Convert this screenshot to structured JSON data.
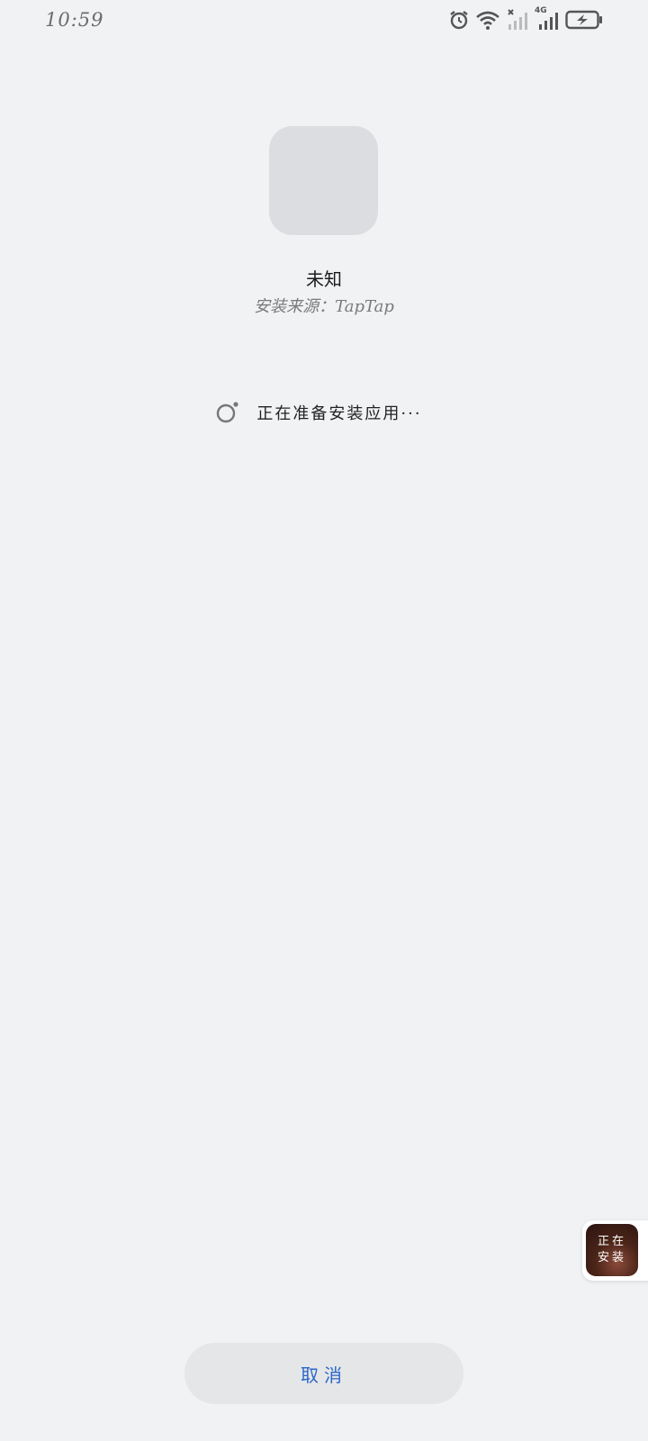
{
  "status_bar": {
    "time": "10:59",
    "network_label": "4G",
    "icons": [
      "alarm-icon",
      "wifi-icon",
      "signal-sim1-icon",
      "signal-sim2-icon",
      "battery-charging-icon"
    ]
  },
  "app": {
    "name": "未知",
    "install_source": "安装来源：TapTap"
  },
  "progress": {
    "text": "正在准备安装应用···",
    "icon": "loading-spinner-icon"
  },
  "floating_widget": {
    "line1": "正在",
    "line2": "安装"
  },
  "actions": {
    "cancel_label": "取消"
  },
  "colors": {
    "background": "#f1f2f4",
    "accent": "#2a66c9",
    "button_bg": "#e5e6e8"
  }
}
